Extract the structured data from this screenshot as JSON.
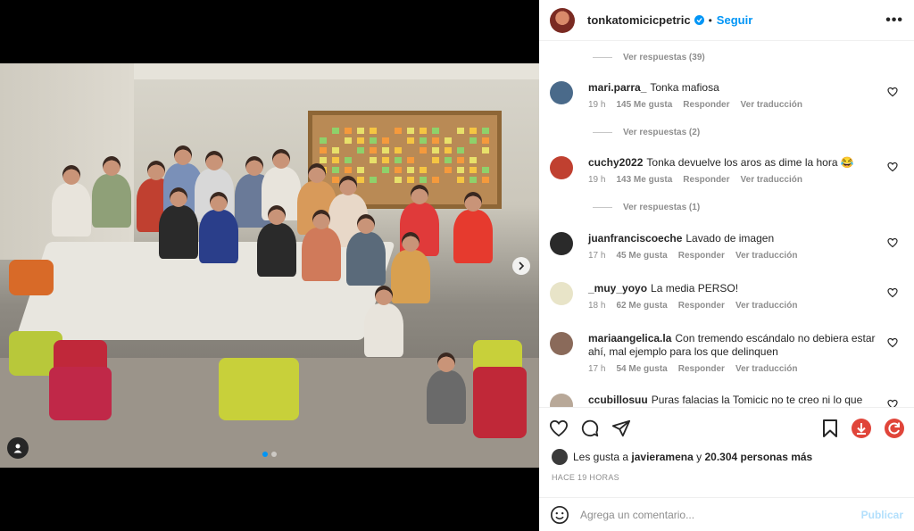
{
  "post": {
    "username": "tonkatomicicpetric",
    "separator": "•",
    "follow_label": "Seguir",
    "more_label": "•••"
  },
  "comments": [
    {
      "type": "replies",
      "label": "Ver respuestas (39)"
    },
    {
      "type": "comment",
      "username": "mari.parra_",
      "text": "Tonka mafiosa",
      "age": "19 h",
      "likes": "145 Me gusta",
      "reply": "Responder",
      "translate": "Ver traducción",
      "avatar_color": "#4a6a8a"
    },
    {
      "type": "replies",
      "label": "Ver respuestas (2)"
    },
    {
      "type": "comment",
      "username": "cuchy2022",
      "text": "Tonka devuelve los aros as dime la hora 😂",
      "age": "19 h",
      "likes": "143 Me gusta",
      "reply": "Responder",
      "translate": "Ver traducción",
      "avatar_color": "#c04030"
    },
    {
      "type": "replies",
      "label": "Ver respuestas (1)"
    },
    {
      "type": "comment",
      "username": "juanfranciscoeche",
      "text": "Lavado de imagen",
      "age": "17 h",
      "likes": "45 Me gusta",
      "reply": "Responder",
      "translate": "Ver traducción",
      "avatar_color": "#2a2a2a"
    },
    {
      "type": "comment",
      "username": "_muy_yoyo",
      "text": "La media PERSO!",
      "age": "18 h",
      "likes": "62 Me gusta",
      "reply": "Responder",
      "translate": "Ver traducción",
      "avatar_color": "#e8e4c8"
    },
    {
      "type": "comment",
      "username": "mariaangelica.la",
      "text": "Con tremendo escándalo no debiera estar ahí, mal ejemplo para los que delinquen",
      "age": "17 h",
      "likes": "54 Me gusta",
      "reply": "Responder",
      "translate": "Ver traducción",
      "avatar_color": "#8a6a5a"
    },
    {
      "type": "comment",
      "username": "ccubillosuu",
      "text": "Puras falacias la Tomicic no te creo ni lo que",
      "age": "",
      "likes": "",
      "reply": "",
      "translate": "",
      "avatar_color": "#b8a898"
    }
  ],
  "likes": {
    "prefix": "Les gusta a",
    "user": "javieramena",
    "middle": "y",
    "count": "20.304 personas más"
  },
  "timestamp": "HACE 19 HORAS",
  "add_comment": {
    "placeholder": "Agrega un comentario...",
    "post_label": "Publicar"
  },
  "colors": {
    "accent": "#0095f6",
    "muted": "#8e8e8e",
    "post_disabled": "#b2dffc"
  },
  "icons": [
    "heart-icon",
    "comment-icon",
    "share-icon",
    "bookmark-icon",
    "download-icon",
    "refresh-icon",
    "emoji-icon",
    "user-tag-icon",
    "chevron-right-icon"
  ]
}
